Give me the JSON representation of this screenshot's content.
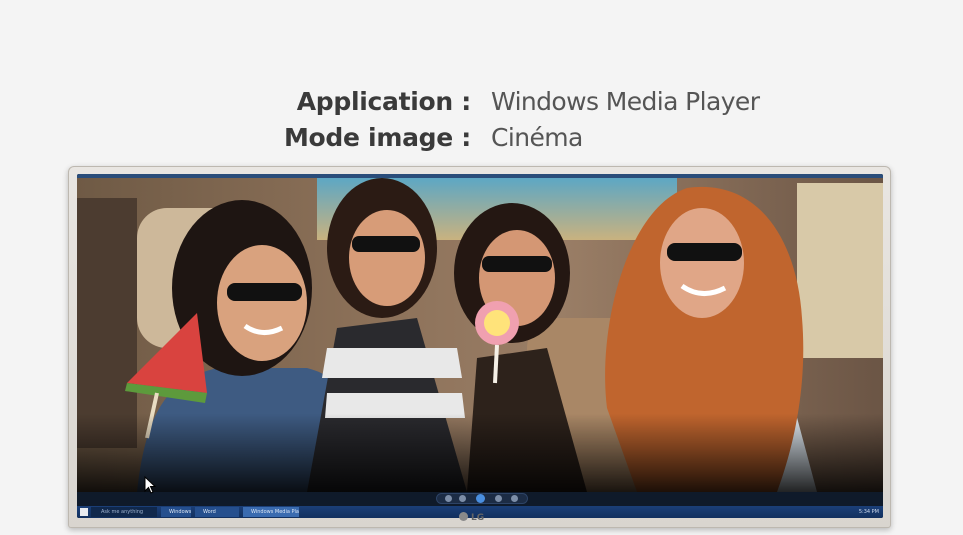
{
  "caption": {
    "application_label": "Application :",
    "application_value": "Windows Media Player",
    "mode_label": "Mode image :",
    "mode_value": "Cinéma"
  },
  "monitor": {
    "brand": "LG"
  },
  "taskbar": {
    "search_placeholder": "Ask me anything",
    "items": [
      "Windows Game",
      "Word",
      "Windows Media Player"
    ],
    "clock": "5:34 PM"
  },
  "icons": [
    "windows-start-icon",
    "search-icon",
    "play-icon",
    "prev-icon",
    "next-icon",
    "stop-icon",
    "mouse-pointer-icon",
    "lg-logo-icon"
  ]
}
